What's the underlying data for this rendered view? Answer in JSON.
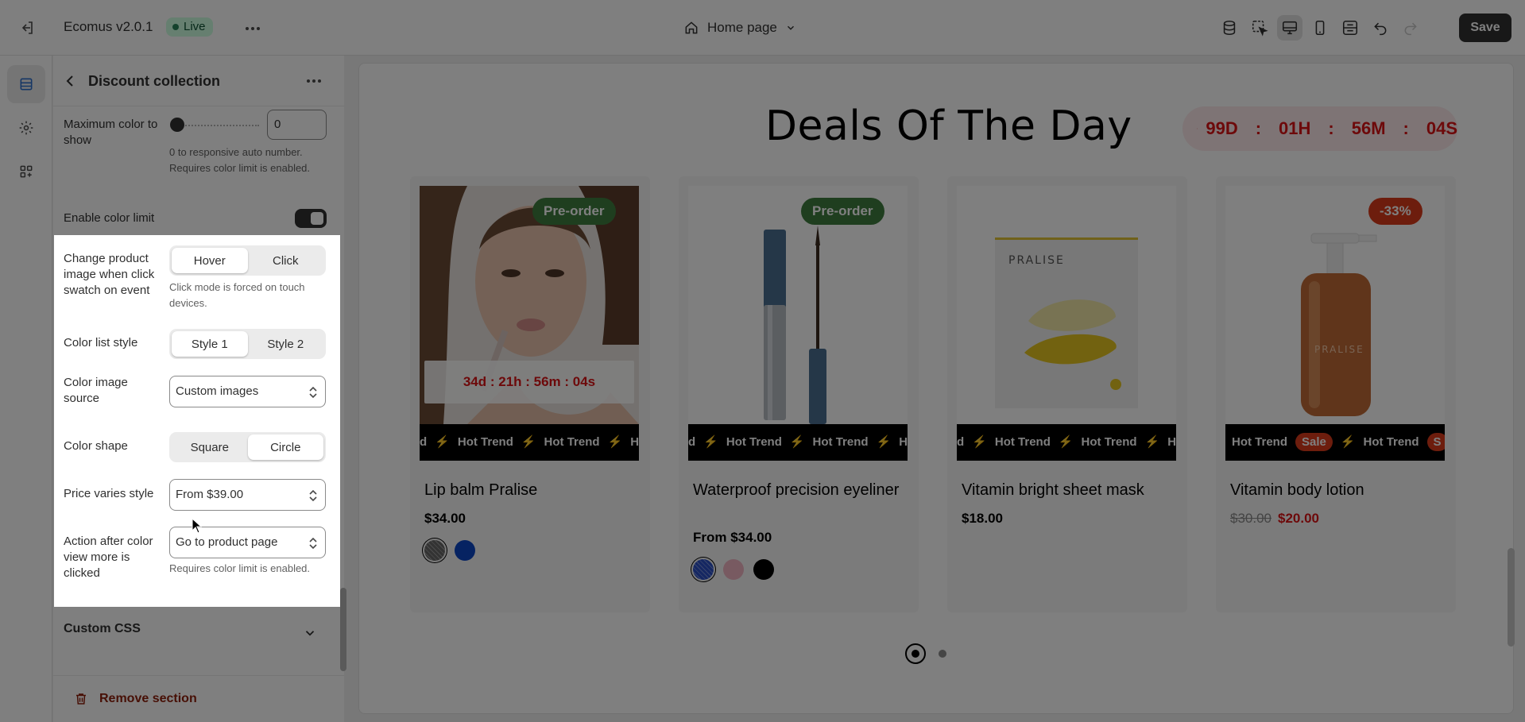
{
  "topbar": {
    "app_name": "Ecomus v2.0.1",
    "status": "Live",
    "page_selector": "Home page",
    "save_label": "Save"
  },
  "panel": {
    "title": "Discount collection",
    "max_color": {
      "label": "Maximum color to show",
      "value": "0",
      "help": "0 to responsive auto number. Requires color limit is enabled."
    },
    "enable_color_limit": {
      "label": "Enable color limit",
      "enabled": true
    },
    "change_image": {
      "label": "Change product image when click swatch on event",
      "options": [
        "Hover",
        "Click"
      ],
      "selected": "Hover",
      "help": "Click mode is forced on touch devices."
    },
    "color_list_style": {
      "label": "Color list style",
      "options": [
        "Style 1",
        "Style 2"
      ],
      "selected": "Style 1"
    },
    "color_image_source": {
      "label": "Color image source",
      "value": "Custom images"
    },
    "color_shape": {
      "label": "Color shape",
      "options": [
        "Square",
        "Circle"
      ],
      "selected": "Circle"
    },
    "price_varies": {
      "label": "Price varies style",
      "value": "From $39.00"
    },
    "action_after": {
      "label": "Action after color view more is clicked",
      "value": "Go to product page",
      "help": "Requires color limit is enabled."
    },
    "custom_css": "Custom CSS",
    "remove_section": "Remove section"
  },
  "preview": {
    "title": "Deals Of The Day",
    "countdown": {
      "days": "99D",
      "hours": "01H",
      "minutes": "56M",
      "seconds": "04S",
      "separator": ":"
    },
    "products": [
      {
        "badge": "Pre-order",
        "badge_color": "#3e7d3f",
        "timer": "34d : 21h : 56m : 04s",
        "marquee": [
          "d",
          "⚡",
          "Hot Trend",
          "⚡",
          "Hot Trend",
          "⚡",
          "Hot"
        ],
        "title": "Lip balm Pralise",
        "price": "$34.00",
        "swatches": [
          "#666666",
          "#0d47c4"
        ]
      },
      {
        "badge": "Pre-order",
        "badge_color": "#3e7d3f",
        "marquee": [
          "d",
          "⚡",
          "Hot Trend",
          "⚡",
          "Hot Trend",
          "⚡",
          "Ho"
        ],
        "title": "Waterproof precision eyeliner",
        "price": "From $34.00",
        "swatches": [
          "#2b4fc4",
          "#f0b4c3",
          "#000000"
        ]
      },
      {
        "marquee": [
          "d",
          "⚡",
          "Hot Trend",
          "⚡",
          "Hot Trend",
          "⚡",
          "Ho"
        ],
        "title": "Vitamin bright sheet mask",
        "price": "$18.00",
        "swatches": []
      },
      {
        "badge": "-33%",
        "badge_color": "#db3b1b",
        "marquee": [
          "Hot Trend",
          "Sale",
          "⚡",
          "Hot Trend",
          "S"
        ],
        "title": "Vitamin body lotion",
        "old_price": "$30.00",
        "price": "$20.00",
        "swatches": []
      }
    ],
    "pagination": {
      "pages": 2,
      "current": 1
    }
  }
}
